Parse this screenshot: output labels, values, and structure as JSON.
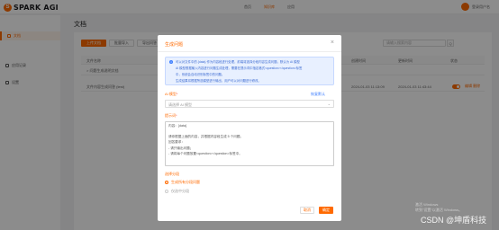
{
  "app": {
    "logo_text": "SPARK AGI",
    "logo_mark": "S"
  },
  "topnav": [
    "首页",
    "知识库",
    "应用"
  ],
  "user": {
    "name": "登录用户名"
  },
  "sidebar": {
    "items": [
      {
        "label": "文档",
        "icon": "document-icon",
        "active": true
      },
      {
        "label": "应用记录",
        "icon": "record-icon",
        "active": false
      },
      {
        "label": "设置",
        "icon": "settings-icon",
        "active": false
      }
    ]
  },
  "page": {
    "title": "文档"
  },
  "toolbar": {
    "upload": "上传文档",
    "batch": "批量导入",
    "export": "导出问答"
  },
  "search": {
    "placeholder": "请输入搜索内容",
    "button": "Q"
  },
  "table": {
    "headers": [
      "文件名称",
      "类型",
      "字数",
      "创建时间",
      "更新时间",
      "状态"
    ],
    "rows": [
      {
        "name": "> 问题生成说明文档",
        "time1": "",
        "time2": ""
      },
      {
        "name": "文件内容生成问答 (test)",
        "time1": "2024-01-03 11:13:09",
        "time2": "2024-01-03 11:43:44",
        "actions": "编辑 删除"
      }
    ]
  },
  "modal": {
    "title": "生成问题",
    "close": "×",
    "info_lines": [
      "可以对文件中的 {data} 作为内容段进行处理，前端将选择分段内容生成问题，默认为 AI 模型",
      "AI 模型根据输入内容进行问题生成处理，需要在提示词中指定格式<question></question>标签",
      "中，系统会自动识别标签中的问题。",
      "生成结果将根据所选模型进行输出，用户可以对问题进行修改。"
    ],
    "model_label": "AI 模型",
    "reset": "恢复默认",
    "model_placeholder": "请选择 AI 模型",
    "prompt_label": "提示词",
    "prompt_lines": [
      "内容：{data}",
      "",
      "请你根据上面的内容，并根据内容段生成 5 个问题。",
      "回答要求：",
      "- 请只输出问题；",
      "- 请将每个问题放置<question></question>标签中。"
    ],
    "option_label": "选择分段",
    "options": [
      {
        "label": "生成所有分段问题",
        "checked": true
      },
      {
        "label": "仅选中分段",
        "checked": false
      }
    ],
    "cancel": "取消",
    "ok": "确定"
  },
  "windows": {
    "line1": "激活 Windows",
    "line2": "转到\"设置\"以激活 Windows。"
  },
  "watermark": "CSDN @坤盾科技",
  "colors": {
    "accent": "#ff6a00",
    "info_bg": "#e8f0ff",
    "info_text": "#3d6bd1"
  }
}
